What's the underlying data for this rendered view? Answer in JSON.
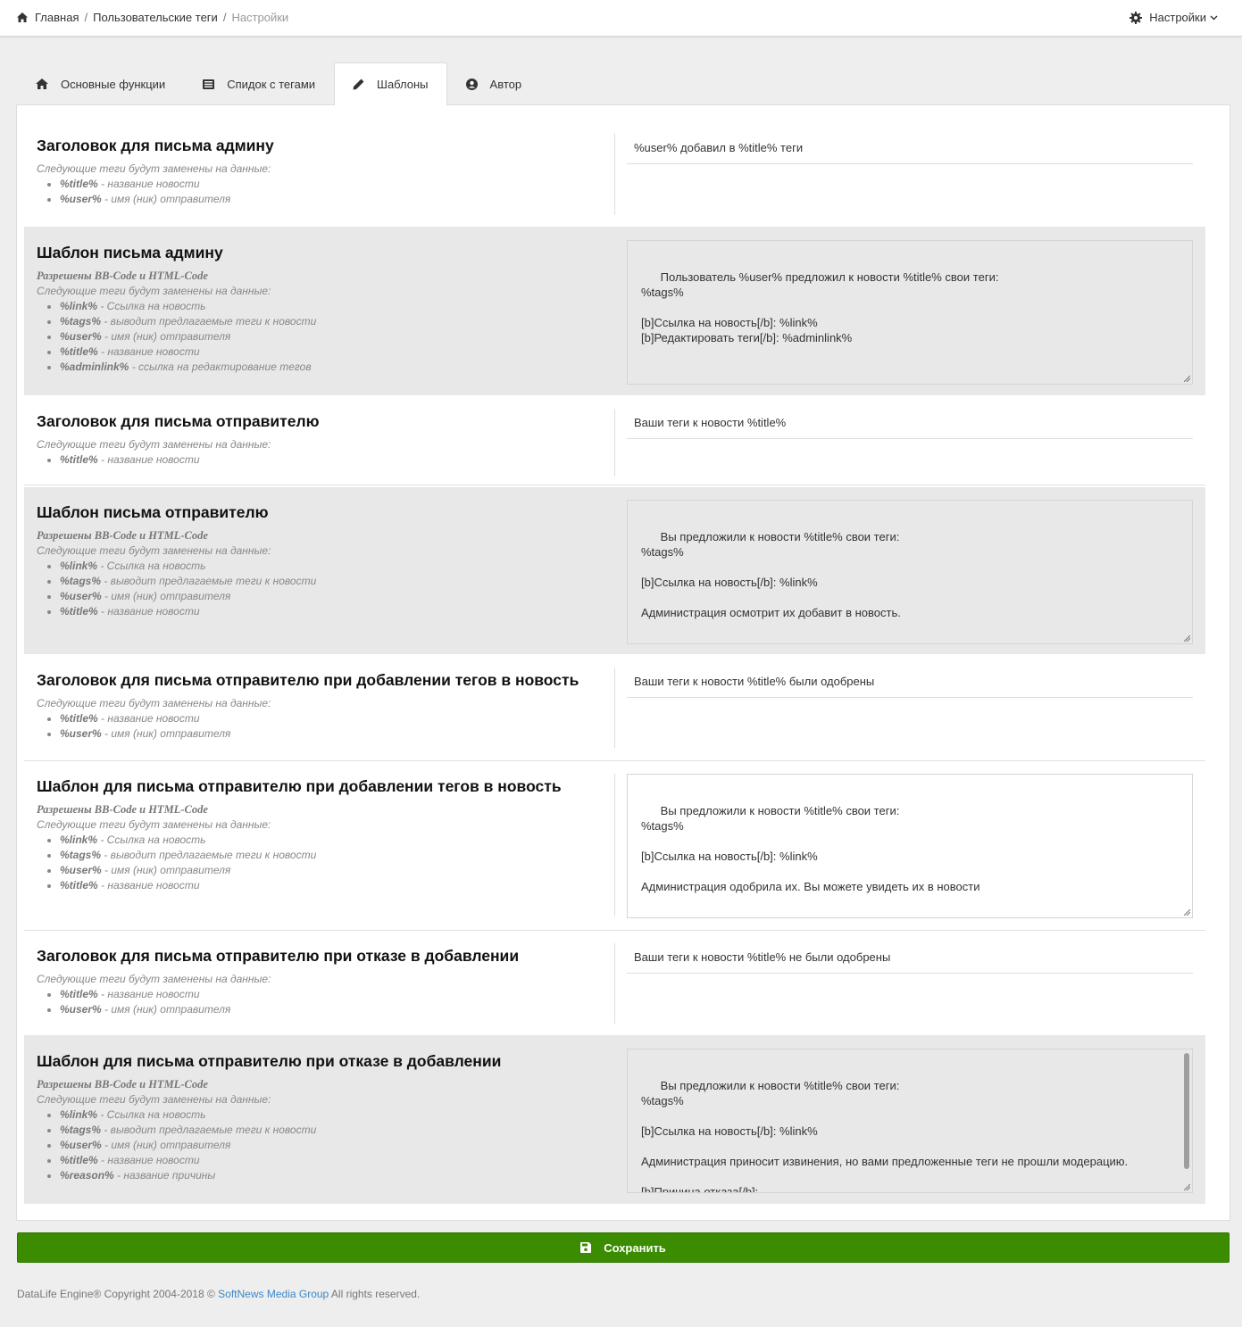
{
  "breadcrumb": {
    "home": "Главная",
    "user_tags": "Пользовательские теги",
    "current": "Настройки"
  },
  "header": {
    "settings_label": "Настройки"
  },
  "tabs": [
    {
      "label": "Основные функции",
      "icon": "home-icon"
    },
    {
      "label": "Спидок с тегами",
      "icon": "list-icon"
    },
    {
      "label": "Шаблоны",
      "icon": "pencil-icon",
      "active": true
    },
    {
      "label": "Автор",
      "icon": "user-circle-icon"
    }
  ],
  "labels": {
    "allowed": "Разрешены BB-Code и HTML-Code",
    "replaced": "Следующие теги будут заменены на данные:"
  },
  "tagdesc": {
    "title": {
      "tag": "%title%",
      "desc": " - название новости"
    },
    "user": {
      "tag": "%user%",
      "desc": " - имя (ник) отправителя"
    },
    "link": {
      "tag": "%link%",
      "desc": " - Ссылка на новость"
    },
    "tags": {
      "tag": "%tags%",
      "desc": " - выводит предлагаемые теги к новости"
    },
    "adminlink": {
      "tag": "%adminlink%",
      "desc": " - ссылка на редактирование тегов"
    },
    "reason": {
      "tag": "%reason%",
      "desc": " - название причины"
    }
  },
  "settings": {
    "admin_subject": {
      "title": "Заголовок для письма админу",
      "value": "%user% добавил в %title% теги"
    },
    "admin_template": {
      "title": "Шаблон письма админу",
      "value": "Пользователь %user% предложил к новости %title% свои теги:\n%tags%\n\n[b]Ссылка на новость[/b]: %link%\n[b]Редактировать теги[/b]: %adminlink%"
    },
    "sender_subject": {
      "title": "Заголовок для письма отправителю",
      "value": "Ваши теги к новости %title%"
    },
    "sender_template": {
      "title": "Шаблон письма отправителю",
      "value": "Вы предложили к новости %title% свои теги:\n%tags%\n\n[b]Ссылка на новость[/b]: %link%\n\nАдминистрация осмотрит их добавит в новость."
    },
    "approve_subject": {
      "title": "Заголовок для письма отправителю при добавлении тегов в новость",
      "value": "Ваши теги к новости %title% были одобрены"
    },
    "approve_template": {
      "title": "Шаблон для письма отправителю при добавлении тегов в новость",
      "value": "Вы предложили к новости %title% свои теги:\n%tags%\n\n[b]Ссылка на новость[/b]: %link%\n\nАдминистрация одобрила их. Вы можете увидеть их в новости"
    },
    "reject_subject": {
      "title": "Заголовок для письма отправителю при отказе в добавлении",
      "value": "Ваши теги к новости %title% не были одобрены"
    },
    "reject_template": {
      "title": "Шаблон для письма отправителю при отказе в добавлении",
      "value": "Вы предложили к новости %title% свои теги:\n%tags%\n\n[b]Ссылка на новость[/b]: %link%\n\nАдминистрация приносит извинения, но вами предложенные теги не прошли модерацию.\n\n[b]Причина отказа[/b]:\n%reason%"
    }
  },
  "save_label": "Сохранить",
  "footer": {
    "prefix": "DataLife Engine® Copyright 2004-2018 © ",
    "link": "SoftNews Media Group",
    "suffix": " All rights reserved."
  },
  "colors": {
    "save_button": "#3b8c00",
    "link": "#3a87c9",
    "shaded_row": "#e8e8e8"
  }
}
